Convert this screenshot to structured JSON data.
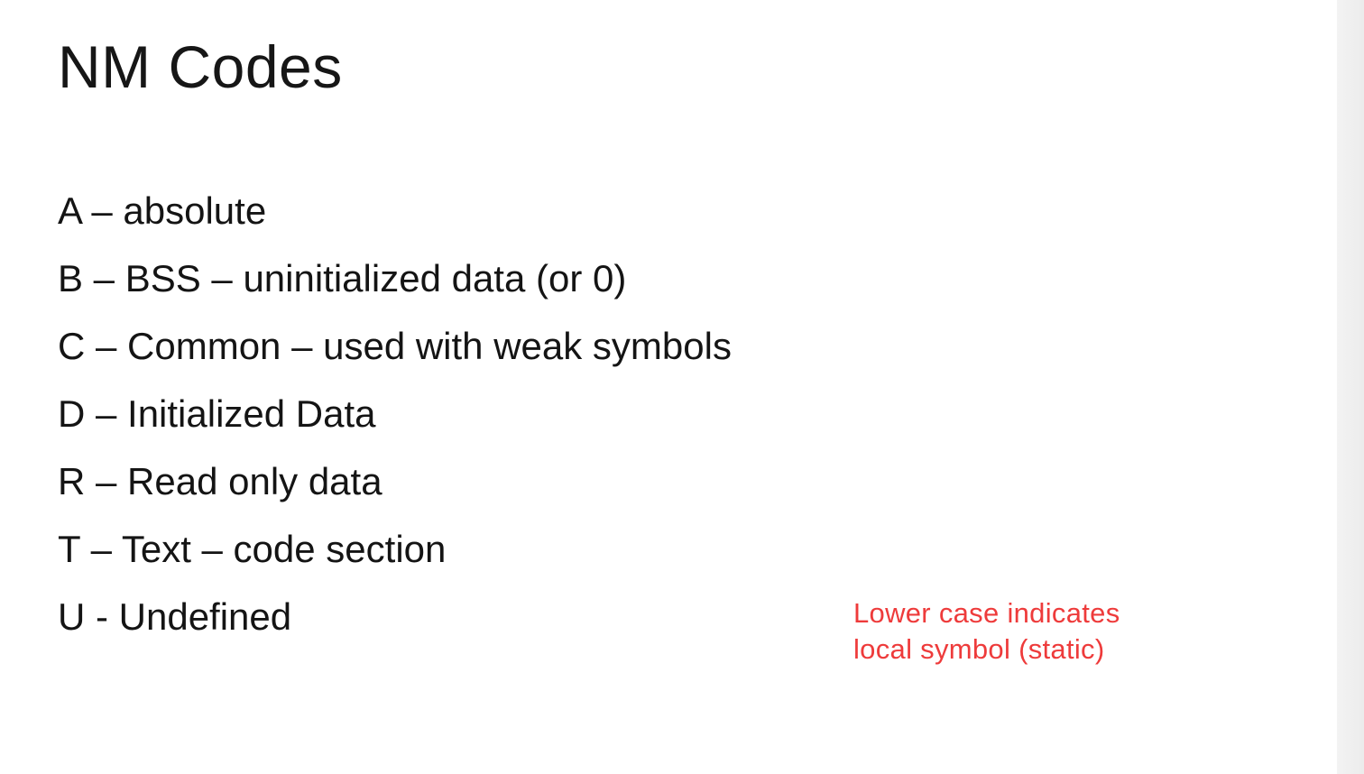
{
  "slide": {
    "title": "NM Codes",
    "codes": [
      "A – absolute",
      "B – BSS – uninitialized data (or 0)",
      "C – Common – used with weak symbols",
      "D – Initialized Data",
      "R – Read only data",
      "T – Text – code section",
      "U - Undefined"
    ],
    "note": {
      "lines": [
        "Lower case indicates",
        "local symbol (static)"
      ],
      "color": "#ee3b3b"
    }
  }
}
